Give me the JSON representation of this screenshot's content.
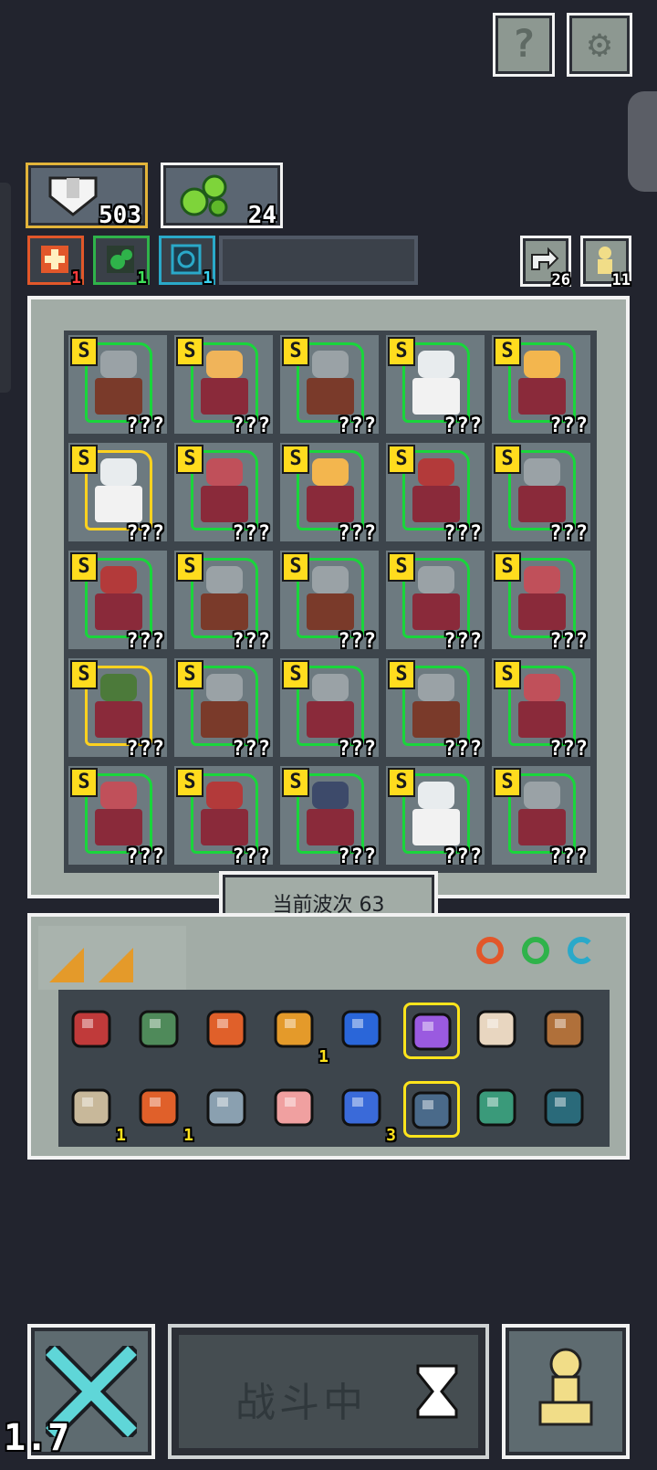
{
  "top_buttons": {
    "help_icon": "help-icon",
    "settings_icon": "gear-icon"
  },
  "resources": {
    "coins": "503",
    "gems": "24"
  },
  "buffs": [
    {
      "icon": "fire-buff-icon",
      "count": "1",
      "color": "#e2572a"
    },
    {
      "icon": "poison-buff-icon",
      "count": "1",
      "color": "#2fb34a"
    },
    {
      "icon": "frost-buff-icon",
      "count": "1",
      "color": "#2aa9c9"
    }
  ],
  "counters": {
    "reroll": "26",
    "units": "11"
  },
  "board": {
    "rank": "S",
    "unknown": "???",
    "units": [
      {
        "type": "knight",
        "color": "#9aa2a6"
      },
      {
        "type": "blonde",
        "color": "#f0b45a"
      },
      {
        "type": "knight",
        "color": "#9aa2a6"
      },
      {
        "type": "priest",
        "color": "#e8ecee"
      },
      {
        "type": "monk",
        "color": "#f3b64e"
      },
      {
        "type": "angel",
        "color": "#e8ecee",
        "gold": true
      },
      {
        "type": "guard",
        "color": "#c0505a"
      },
      {
        "type": "monk",
        "color": "#f3b64e"
      },
      {
        "type": "warrior",
        "color": "#b33a3a"
      },
      {
        "type": "knight-helm",
        "color": "#9aa2a6"
      },
      {
        "type": "warrior",
        "color": "#b33a3a"
      },
      {
        "type": "shield",
        "color": "#9aa2a6"
      },
      {
        "type": "knight",
        "color": "#9aa2a6"
      },
      {
        "type": "knight-helm",
        "color": "#9aa2a6"
      },
      {
        "type": "elder",
        "color": "#c0505a"
      },
      {
        "type": "treant",
        "color": "#4c7a3a",
        "gold": true
      },
      {
        "type": "shield",
        "color": "#9aa2a6"
      },
      {
        "type": "knight-helm",
        "color": "#9aa2a6"
      },
      {
        "type": "knight",
        "color": "#9aa2a6"
      },
      {
        "type": "elder",
        "color": "#c0505a"
      },
      {
        "type": "elder",
        "color": "#c0505a"
      },
      {
        "type": "warrior",
        "color": "#b33a3a"
      },
      {
        "type": "bishop",
        "color": "#3d4a6a"
      },
      {
        "type": "priest",
        "color": "#e8ecee"
      },
      {
        "type": "knight-helm",
        "color": "#9aa2a6"
      }
    ]
  },
  "wave": {
    "label": "当前波次 63"
  },
  "inventory": {
    "items": [
      {
        "icon": "crab-icon",
        "color": "#c03a3a",
        "count": ""
      },
      {
        "icon": "turtle-shell-icon",
        "color": "#4f8a5a",
        "count": ""
      },
      {
        "icon": "scroll-slash-icon",
        "color": "#e0602a",
        "count": ""
      },
      {
        "icon": "orb-ring-icon",
        "color": "#e49a2a",
        "count": "1"
      },
      {
        "icon": "water-drop-icon",
        "color": "#2a66d9",
        "count": ""
      },
      {
        "icon": "magic-staff-icon",
        "color": "#9a5ae0",
        "count": "",
        "selected": true
      },
      {
        "icon": "crown-spikes-icon",
        "color": "#e8d6c0",
        "count": ""
      },
      {
        "icon": "feather-icon",
        "color": "#b0703a",
        "count": ""
      },
      {
        "icon": "map-scroll-icon",
        "color": "#c8b89a",
        "count": "1"
      },
      {
        "icon": "axe-icon",
        "color": "#e0602a",
        "count": "1"
      },
      {
        "icon": "swirl-stone-icon",
        "color": "#8aa0b0",
        "count": ""
      },
      {
        "icon": "eye-hand-icon",
        "color": "#f0a0a0",
        "count": ""
      },
      {
        "icon": "hourglass-icon",
        "color": "#3a6ad9",
        "count": "3"
      },
      {
        "icon": "crystal-claw-icon",
        "color": "#4a6a8a",
        "count": "",
        "selected": true
      },
      {
        "icon": "crystal-cluster-icon",
        "color": "#3a9a7a",
        "count": ""
      },
      {
        "icon": "bell-icon",
        "color": "#2a6a7a",
        "count": ""
      }
    ]
  },
  "bottom": {
    "battle_label": "战斗中",
    "speed": "1.7"
  }
}
